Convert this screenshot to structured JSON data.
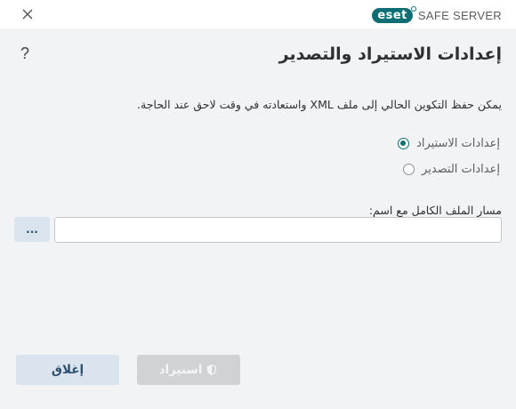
{
  "window": {
    "brand_logo": "eset",
    "product_name": "SAFE SERVER",
    "close_icon": "close-icon"
  },
  "dialog": {
    "title": "إعدادات الاستيراد والتصدير",
    "help_label": "?",
    "description": "يمكن حفظ التكوين الحالي إلى ملف XML واستعادته في وقت لاحق عند الحاجة.",
    "options": [
      {
        "label": "إعدادات الاستيراد",
        "selected": true
      },
      {
        "label": "إعدادات التصدير",
        "selected": false
      }
    ],
    "path_label": "مسار الملف الكامل مع اسم:",
    "path_value": "",
    "browse_label": "...",
    "import_label": "استيراد",
    "import_enabled": false,
    "close_label": "إغلاق"
  },
  "colors": {
    "accent": "#0d6e74",
    "secondary_button_bg": "#d9e4ee",
    "disabled_button_bg": "#d0d2d5",
    "background": "#f2f3f5"
  }
}
